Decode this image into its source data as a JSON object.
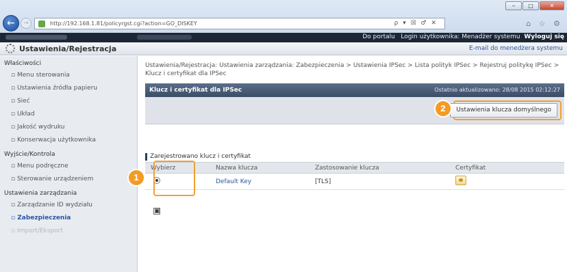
{
  "browser": {
    "url": "http://192.168.1.81/policyrgst.cgi?action=GO_DISKEY",
    "addr_tools": "ρ ▾ ☒ ♂ ✕",
    "win_buttons": [
      "‒",
      "□",
      "✕"
    ],
    "toolbar_icons": "⌂ ☆ ⚙",
    "back_icon": "←",
    "forward_icon": "→"
  },
  "topbar": {
    "portal_link": "Do portalu",
    "login_label": "Login użytkownika: Menadżer systemu",
    "logout_link": "Wyloguj się"
  },
  "header": {
    "title": "Ustawienia/Rejestracja",
    "mail_link": "E-mail do menedżera systemu"
  },
  "sidebar": {
    "groups": [
      {
        "label": "Właściwości",
        "items": [
          "Menu sterowania",
          "Ustawienia źródła papieru",
          "Sieć",
          "Układ",
          "Jakość wydruku",
          "Konserwacja użytkownika"
        ]
      },
      {
        "label": "Wyjście/Kontrola",
        "items": [
          "Menu podręczne",
          "Sterowanie urządzeniem"
        ]
      },
      {
        "label": "Ustawienia zarządzania",
        "items": [
          "Zarządzanie ID wydziału",
          "Zabezpieczenia",
          "Import/Eksport"
        ]
      }
    ]
  },
  "main": {
    "breadcrumb": "Ustawienia/Rejestracja: Ustawienia zarządzania: Zabezpieczenia > Ustawienia IPSec > Lista polityk IPSec > Rejestruj politykę IPSec > Klucz i certyfikat dla IPSec",
    "panel_title": "Klucz i certyfikat dla IPSec",
    "last_updated": "Ostatnio aktualizowano: 28/08 2015 02:12:27",
    "default_key_button": "Ustawienia klucza domyślnego",
    "section_title": "Zarejestrowano klucz i certyfikat",
    "table": {
      "headers": [
        "Wybierz",
        "Nazwa klucza",
        "Zastosowanie klucza",
        "Certyfikat"
      ],
      "rows": [
        {
          "key_name": "Default Key",
          "usage": "[TLS]"
        }
      ]
    },
    "callouts": [
      "1",
      "2"
    ],
    "collapse_icon": "▣"
  }
}
